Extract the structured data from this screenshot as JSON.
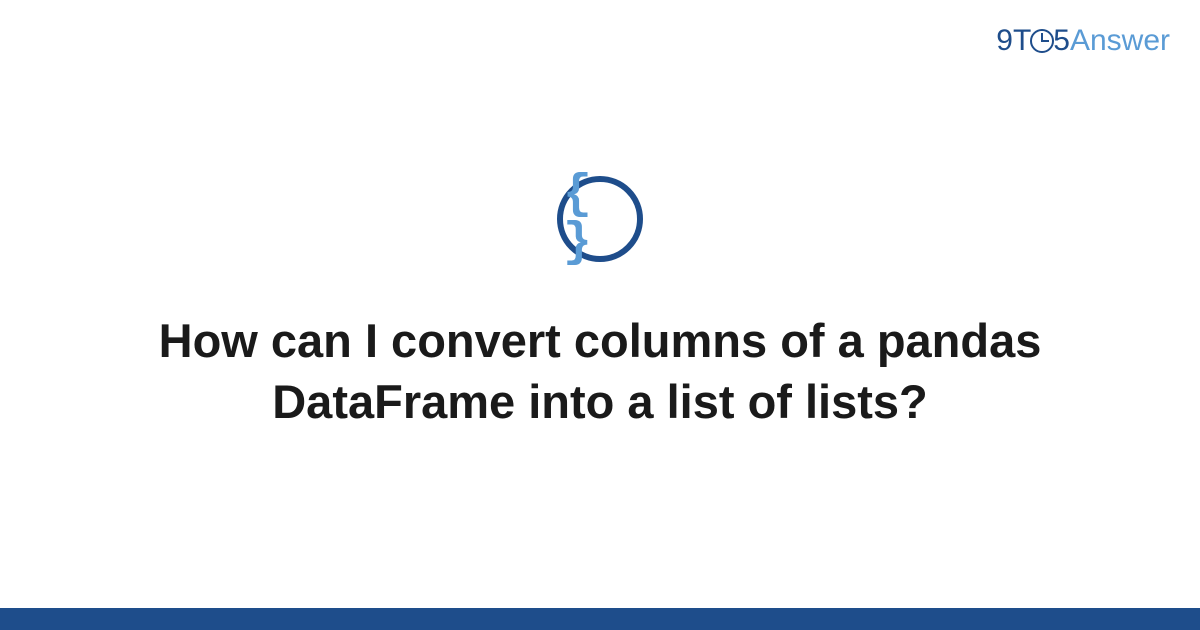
{
  "logo": {
    "nine": "9",
    "t": "T",
    "five": "5",
    "answer": "Answer"
  },
  "icon": {
    "braces": "{ }",
    "name": "code-braces-icon"
  },
  "question": {
    "title": "How can I convert columns of a pandas DataFrame into a list of lists?"
  },
  "colors": {
    "primary": "#1e4d8b",
    "accent": "#5a9bd5"
  }
}
